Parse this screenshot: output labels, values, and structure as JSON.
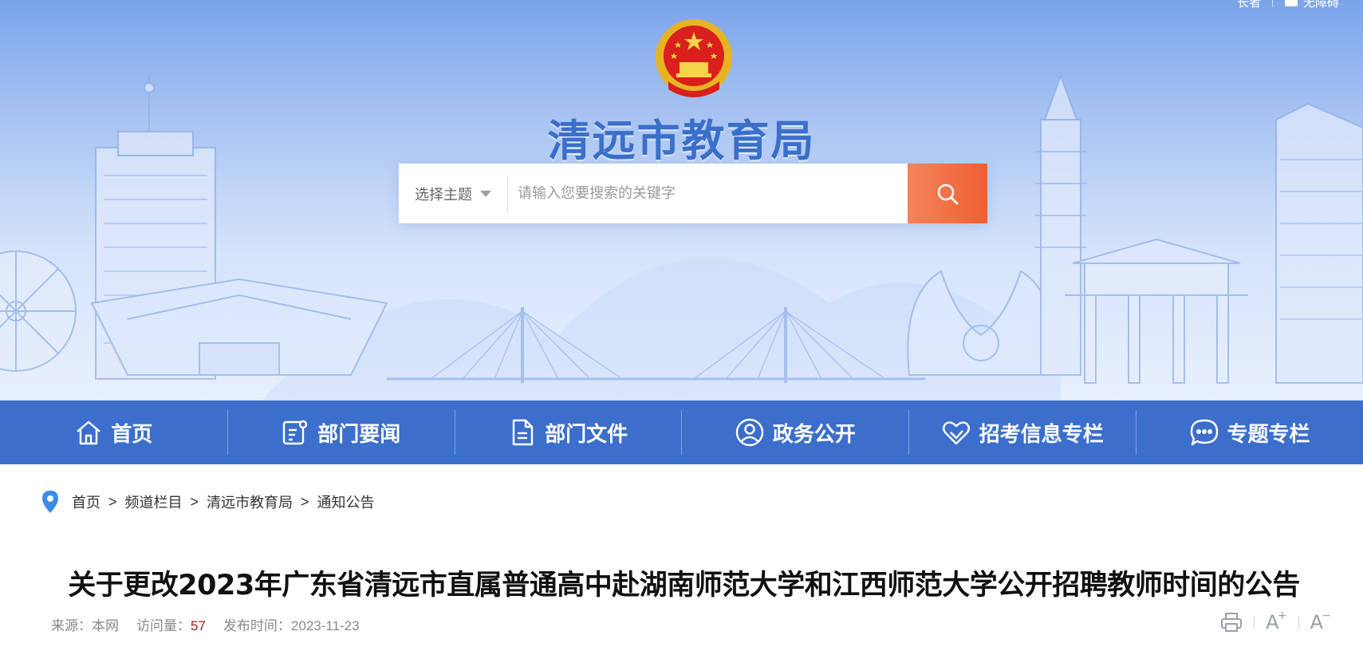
{
  "top_links": {
    "elder_label": "长者",
    "accessibility_label": "无障碍"
  },
  "header": {
    "site_title": "清远市教育局"
  },
  "search": {
    "topic_label": "选择主题",
    "placeholder": "请输入您要搜索的关键字",
    "value": ""
  },
  "nav": {
    "items": [
      {
        "label": "首页",
        "icon": "home-icon"
      },
      {
        "label": "部门要闻",
        "icon": "news-icon"
      },
      {
        "label": "部门文件",
        "icon": "document-icon"
      },
      {
        "label": "政务公开",
        "icon": "user-circle-icon"
      },
      {
        "label": "招考信息专栏",
        "icon": "heart-hand-icon"
      },
      {
        "label": "专题专栏",
        "icon": "chat-icon"
      }
    ]
  },
  "breadcrumb": {
    "items": [
      "首页",
      "频道栏目",
      "清远市教育局",
      "通知公告"
    ],
    "separator": ">"
  },
  "article": {
    "title": "关于更改2023年广东省清远市直属普通高中赴湖南师范大学和江西师范大学公开招聘教师时间的公告",
    "source_label": "来源：",
    "source_value": "本网",
    "views_label": "访问量：",
    "views_value": "57",
    "date_label": "发布时间：",
    "date_value": "2023-11-23"
  },
  "tools": {
    "print_icon": "printer-icon",
    "font_increase": "A",
    "font_increase_sign": "+",
    "font_decrease": "A",
    "font_decrease_sign": "−"
  },
  "colors": {
    "nav_bg": "#3c6fcb",
    "title_blue": "#3a6fca",
    "search_button": "#ee5f33",
    "views_red": "#a11d1d"
  }
}
